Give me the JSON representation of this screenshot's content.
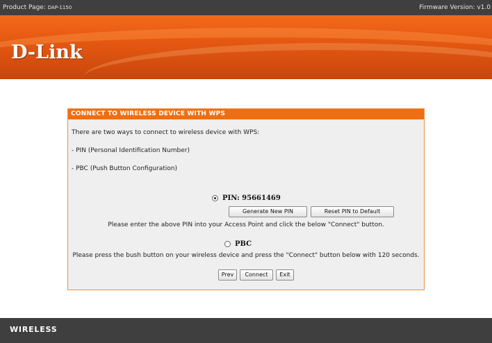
{
  "topbar": {
    "product_prefix": "Product Page: ",
    "product_model": "DAP-1150",
    "firmware": "Firmware Version: v1.0"
  },
  "brand": {
    "logo": "D-Link"
  },
  "wps_panel": {
    "title": "CONNECT TO WIRELESS DEVICE WITH WPS",
    "intro": "There are two ways to connect to wireless device with WPS:",
    "option_pin_desc": "- PIN (Personal Identification Number)",
    "option_pbc_desc": "- PBC (Push Button Configuration)",
    "pin": {
      "label": "PIN: 95661469",
      "selected": true,
      "generate_button": "Generate New PIN",
      "reset_button": "Reset PIN to Default",
      "instruction": "Please enter the above PIN into your Access Point and click the below \"Connect\" button."
    },
    "pbc": {
      "label": "PBC",
      "selected": false,
      "instruction": "Please press the bush button on your wireless device and press the \"Connect\" button below with 120 seconds."
    },
    "buttons": {
      "prev": "Prev",
      "connect": "Connect",
      "exit": "Exit"
    }
  },
  "footer": {
    "label": "WIRELESS"
  },
  "colors": {
    "accent_orange": "#ee6f12",
    "dark_bar": "#3f3f3f",
    "panel_bg": "#efefef"
  }
}
